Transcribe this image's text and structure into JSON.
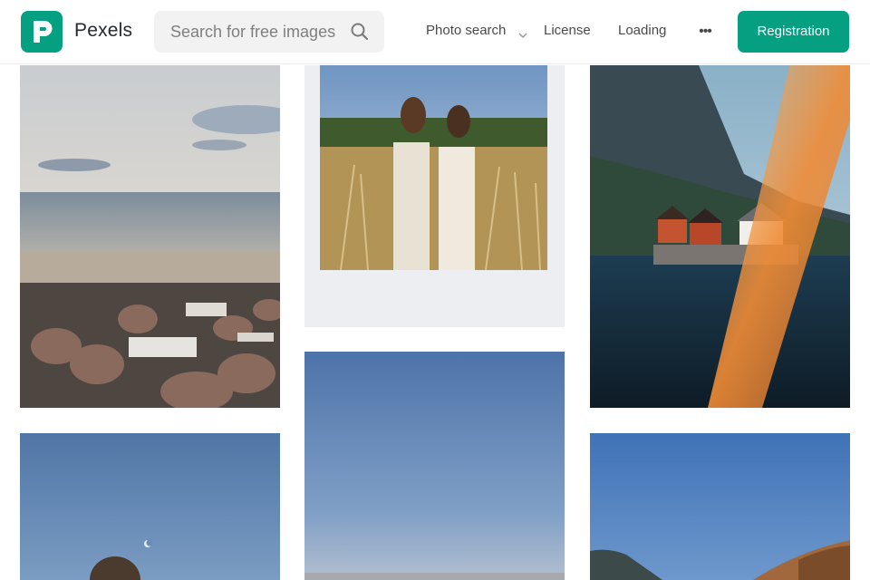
{
  "brand": {
    "name": "Pexels",
    "logo_icon": "pexels-logo-icon",
    "accent_color": "#05a081"
  },
  "search": {
    "placeholder": "Search for free images",
    "icon": "search-icon"
  },
  "nav": {
    "photo_search": "Photo search",
    "license": "License",
    "loading": "Loading",
    "more": "•••"
  },
  "registration_button": "Registration",
  "gallery": {
    "photos": [
      {
        "subject": "beach-lounge-beanbags"
      },
      {
        "subject": "polaroid-two-women-field"
      },
      {
        "subject": "fjord-red-white-houses"
      },
      {
        "subject": "blue-sky-moon"
      },
      {
        "subject": "blue-sky-gradient"
      },
      {
        "subject": "blue-sky-hills"
      }
    ]
  }
}
